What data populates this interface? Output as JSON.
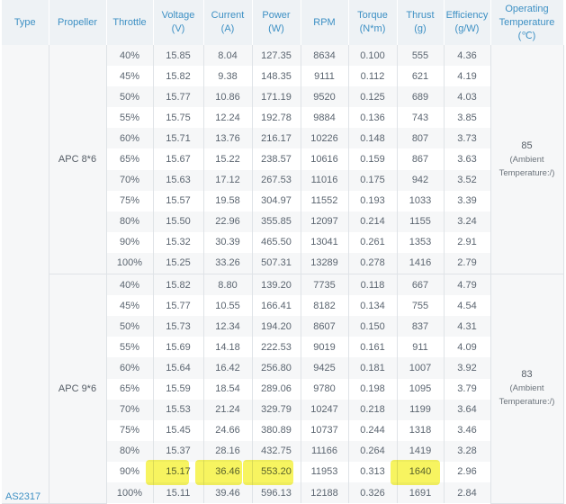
{
  "headers": [
    "Type",
    "Propeller",
    "Throttle",
    "Voltage\n(V)",
    "Current\n(A)",
    "Power\n(W)",
    "RPM",
    "Torque\n(N*m)",
    "Thrust\n(g)",
    "Efficiency\n(g/W)",
    "Operating\nTemperature\n(℃)"
  ],
  "type_label": "AS2317",
  "groups": [
    {
      "propeller": "APC 8*6",
      "op_temp": "85",
      "op_temp_note": "(Ambient Temperature:/)",
      "rows": [
        [
          "40%",
          "15.85",
          "8.04",
          "127.35",
          "8634",
          "0.100",
          "555",
          "4.36"
        ],
        [
          "45%",
          "15.82",
          "9.38",
          "148.35",
          "9111",
          "0.112",
          "621",
          "4.19"
        ],
        [
          "50%",
          "15.77",
          "10.86",
          "171.19",
          "9520",
          "0.125",
          "689",
          "4.03"
        ],
        [
          "55%",
          "15.75",
          "12.24",
          "192.78",
          "9884",
          "0.136",
          "743",
          "3.85"
        ],
        [
          "60%",
          "15.71",
          "13.76",
          "216.17",
          "10226",
          "0.148",
          "807",
          "3.73"
        ],
        [
          "65%",
          "15.67",
          "15.22",
          "238.57",
          "10616",
          "0.159",
          "867",
          "3.63"
        ],
        [
          "70%",
          "15.63",
          "17.12",
          "267.53",
          "11016",
          "0.175",
          "942",
          "3.52"
        ],
        [
          "75%",
          "15.57",
          "19.58",
          "304.97",
          "11552",
          "0.193",
          "1033",
          "3.39"
        ],
        [
          "80%",
          "15.50",
          "22.96",
          "355.85",
          "12097",
          "0.214",
          "1155",
          "3.24"
        ],
        [
          "90%",
          "15.32",
          "30.39",
          "465.50",
          "13041",
          "0.261",
          "1353",
          "2.91"
        ],
        [
          "100%",
          "15.25",
          "33.26",
          "507.31",
          "13289",
          "0.278",
          "1416",
          "2.79"
        ]
      ]
    },
    {
      "propeller": "APC 9*6",
      "op_temp": "83",
      "op_temp_note": "(Ambient Temperature:/)",
      "rows": [
        [
          "40%",
          "15.82",
          "8.80",
          "139.20",
          "7735",
          "0.118",
          "667",
          "4.79"
        ],
        [
          "45%",
          "15.77",
          "10.55",
          "166.41",
          "8182",
          "0.134",
          "755",
          "4.54"
        ],
        [
          "50%",
          "15.73",
          "12.34",
          "194.20",
          "8607",
          "0.150",
          "837",
          "4.31"
        ],
        [
          "55%",
          "15.69",
          "14.18",
          "222.53",
          "9019",
          "0.161",
          "911",
          "4.09"
        ],
        [
          "60%",
          "15.64",
          "16.42",
          "256.80",
          "9425",
          "0.181",
          "1007",
          "3.92"
        ],
        [
          "65%",
          "15.59",
          "18.54",
          "289.06",
          "9780",
          "0.198",
          "1095",
          "3.79"
        ],
        [
          "70%",
          "15.53",
          "21.24",
          "329.79",
          "10247",
          "0.218",
          "1199",
          "3.64"
        ],
        [
          "75%",
          "15.45",
          "24.66",
          "380.89",
          "10737",
          "0.244",
          "1318",
          "3.46"
        ],
        [
          "80%",
          "15.37",
          "28.16",
          "432.75",
          "11166",
          "0.264",
          "1419",
          "3.28"
        ],
        [
          "90%",
          "15.17",
          "36.46",
          "553.20",
          "11953",
          "0.313",
          "1640",
          "2.96"
        ],
        [
          "100%",
          "15.11",
          "39.46",
          "596.13",
          "12188",
          "0.326",
          "1691",
          "2.84"
        ]
      ]
    }
  ],
  "highlight_color": "#f4f02a"
}
